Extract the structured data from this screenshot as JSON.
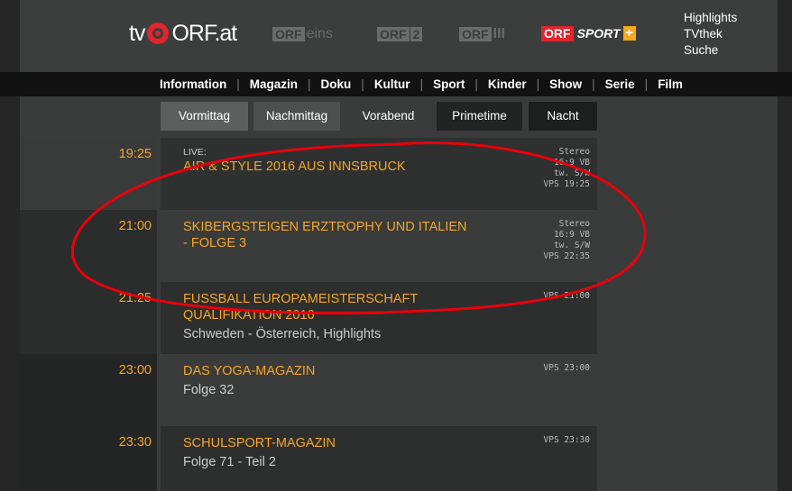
{
  "header": {
    "logo": {
      "tv": "tv",
      "orf": "ORF.at"
    },
    "channels": [
      {
        "name": "ORF eins",
        "parts": [
          "ORF",
          "eins"
        ]
      },
      {
        "name": "ORF 2",
        "parts": [
          "ORF",
          "2"
        ]
      },
      {
        "name": "ORF III",
        "parts": [
          "ORF",
          "III"
        ]
      },
      {
        "name": "ORF SPORT +",
        "parts": [
          "ORF",
          "SPORT",
          "+"
        ]
      }
    ],
    "links": [
      "Highlights",
      "TVthek",
      "Suche"
    ]
  },
  "nav": [
    "Information",
    "Magazin",
    "Doku",
    "Kultur",
    "Sport",
    "Kinder",
    "Show",
    "Serie",
    "Film"
  ],
  "tabs": [
    "Vormittag",
    "Nachmittag",
    "Vorabend",
    "Primetime",
    "Nacht"
  ],
  "programs": [
    {
      "time": "19:25",
      "live": "LIVE:",
      "title": "AIR & STYLE 2016 AUS INNSBRUCK",
      "title2": "",
      "sub": "",
      "meta": [
        "Stereo",
        "16:9 VB",
        "tw. S/W",
        "VPS 19:25"
      ]
    },
    {
      "time": "21:00",
      "live": "",
      "title": "SKIBERGSTEIGEN ERZTROPHY UND ITALIEN",
      "title2": "- FOLGE 3",
      "sub": "",
      "meta": [
        "Stereo",
        "16:9 VB",
        "tw. S/W",
        "VPS 22:35"
      ]
    },
    {
      "time": "21:25",
      "live": "",
      "title": "FUSSBALL EUROPAMEISTERSCHAFT",
      "title2": "QUALIFIKATION 2016",
      "sub": "Schweden - Österreich, Highlights",
      "meta": [
        "VPS 21:00"
      ]
    },
    {
      "time": "23:00",
      "live": "",
      "title": "DAS YOGA-MAGAZIN",
      "title2": "",
      "sub": "Folge 32",
      "meta": [
        "VPS 23:00"
      ]
    },
    {
      "time": "23:30",
      "live": "",
      "title": "SCHULSPORT-MAGAZIN",
      "title2": "",
      "sub": "Folge 71 - Teil 2",
      "meta": [
        "VPS 23:30"
      ]
    }
  ],
  "colors": {
    "accent": "#f5a623",
    "annotation": "#e8000b",
    "sport_red": "#e2242b",
    "sport_plus": "#f5a81d"
  }
}
